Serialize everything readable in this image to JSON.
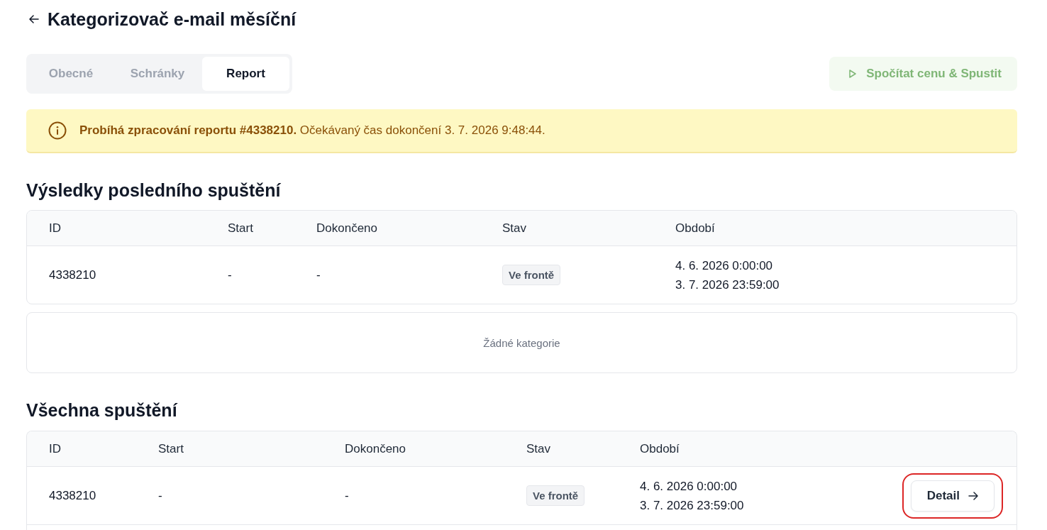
{
  "header": {
    "title": "Kategorizovač e-mail měsíční"
  },
  "tabs": [
    {
      "label": "Obecné",
      "selected": false
    },
    {
      "label": "Schránky",
      "selected": false
    },
    {
      "label": "Report",
      "selected": true
    }
  ],
  "run_button": {
    "label": "Spočítat cenu & Spustit",
    "disabled": true
  },
  "alert": {
    "kind": "warning",
    "text": "**Probíhá zpracování reportu #4338210.** Očekávaný čas dokončení 3. 7. 2026 9:48:44."
  },
  "latest_results": {
    "title": "Výsledky posledního spuštění",
    "columns": [
      "ID",
      "Start",
      "Dokončeno",
      "Stav",
      "Období"
    ],
    "rows": [
      {
        "id": "4338210",
        "start": "-",
        "finished": "-",
        "status": "Ve frontě",
        "period": [
          "4. 6. 2026 0:00:00",
          "3. 7. 2026 23:59:00"
        ]
      }
    ],
    "empty_categories": "Žádné kategorie"
  },
  "all_runs": {
    "title": "Všechna spuštění",
    "columns": [
      "ID",
      "Start",
      "Dokončeno",
      "Stav",
      "Období"
    ],
    "rows": [
      {
        "id": "4338210",
        "start": "-",
        "finished": "-",
        "status": "Ve frontě",
        "period": [
          "4. 6. 2026 0:00:00",
          "3. 7. 2026 23:59:00"
        ],
        "action": {
          "label": "Detail",
          "focused": true
        }
      }
    ]
  }
}
